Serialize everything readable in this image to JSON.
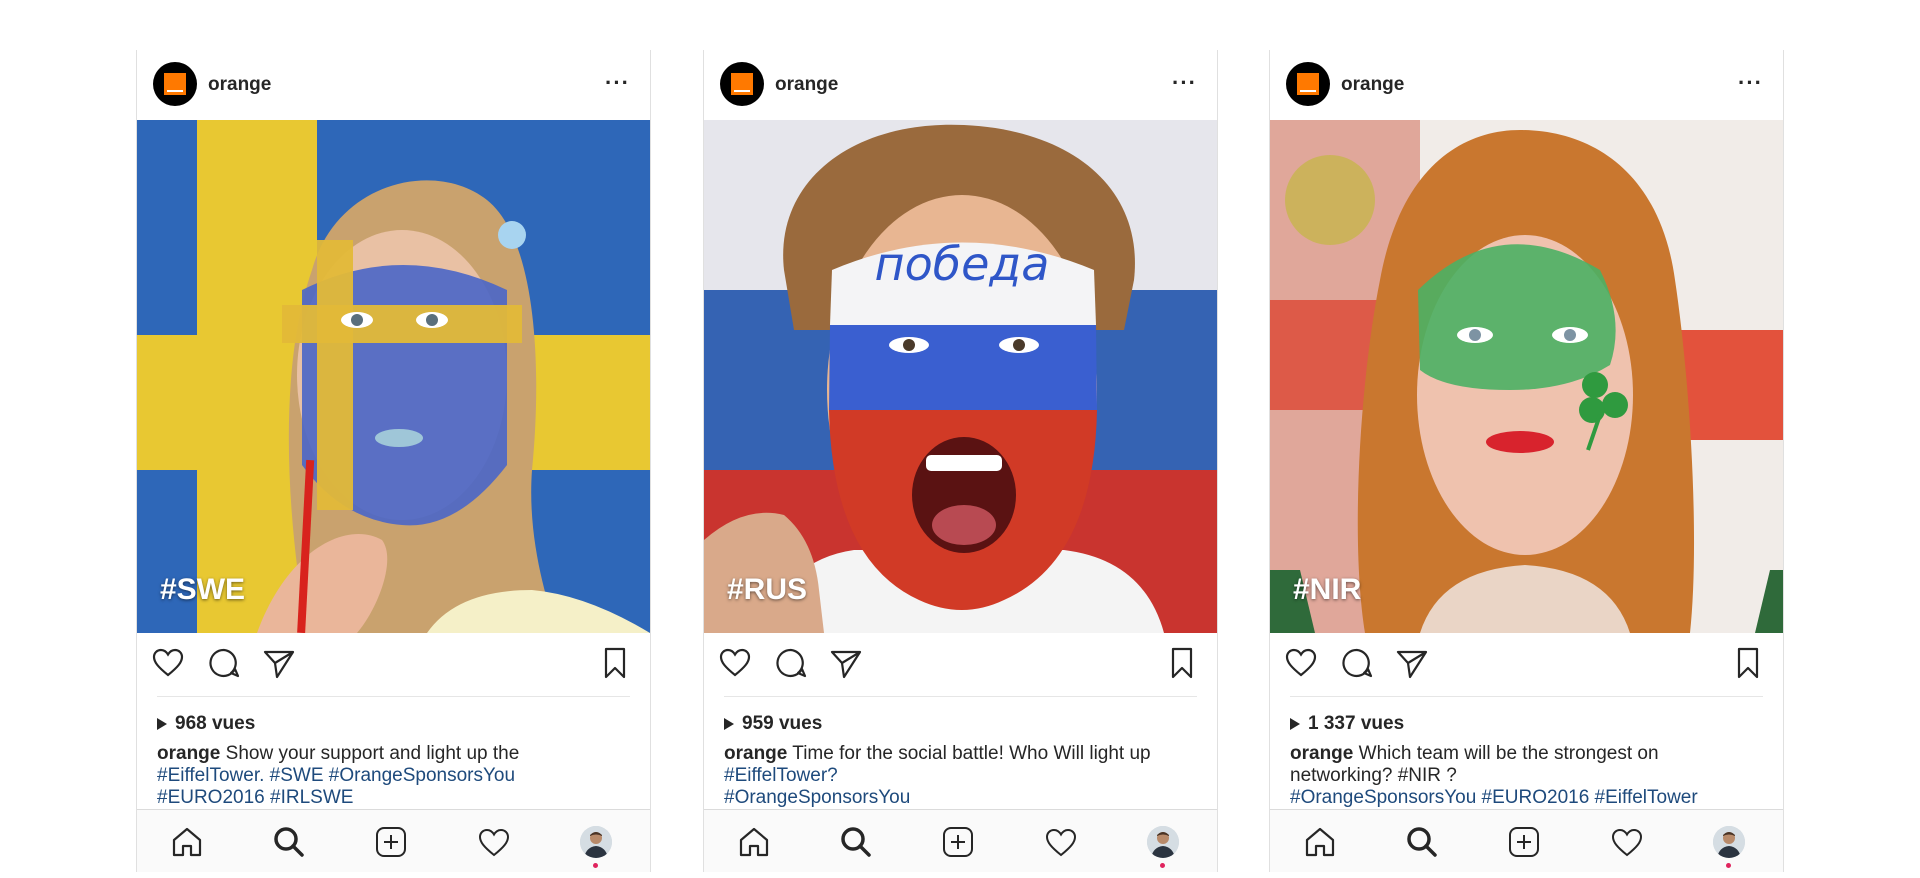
{
  "posts": [
    {
      "username": "orange",
      "overlay_tag": "#SWE",
      "views": "968 vues",
      "caption_user": "orange",
      "caption_lines": [
        "Show your support and light up the",
        "#EiffelTower. #SWE #OrangeSponsorsYou",
        "#EURO2016 #IRLSWE"
      ]
    },
    {
      "username": "orange",
      "overlay_tag": "#RUS",
      "views": "959 vues",
      "caption_user": "orange",
      "caption_lines": [
        "Time for the social battle! Who Will light up",
        "#EiffelTower?",
        "#OrangeSponsorsYou"
      ]
    },
    {
      "username": "orange",
      "overlay_tag": "#NIR",
      "views": "1 337 vues",
      "caption_user": "orange",
      "caption_lines": [
        "Which team will be the strongest on",
        "networking? #NIR ?",
        "#OrangeSponsorsYou #EURO2016 #EiffelTower"
      ]
    }
  ],
  "icons": {
    "header": "more-options-icon",
    "actions": [
      "heart-icon",
      "comment-icon",
      "share-icon",
      "bookmark-icon"
    ],
    "tabbar": [
      "home-icon",
      "search-icon",
      "add-post-icon",
      "activity-heart-icon",
      "profile-avatar"
    ]
  },
  "colors": {
    "brand_orange": "#ff7900",
    "hashtag": "#1e4a7c",
    "notification_dot": "#e0245e"
  }
}
